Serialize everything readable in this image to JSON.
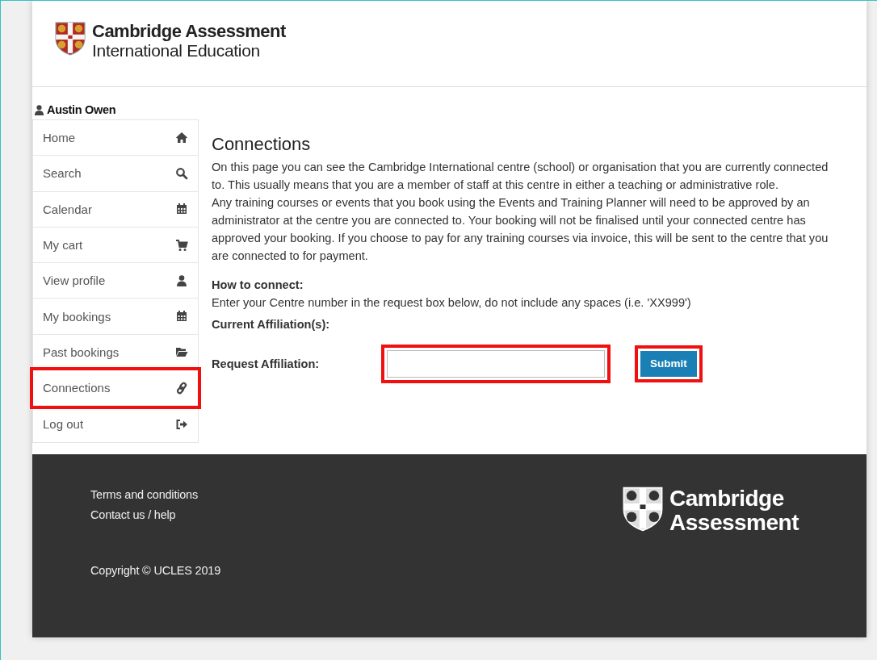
{
  "header": {
    "logo_line1": "Cambridge Assessment",
    "logo_line2": "International Education"
  },
  "user": {
    "name": "Austin Owen"
  },
  "nav": [
    {
      "label": "Home",
      "highlighted": false
    },
    {
      "label": "Search",
      "highlighted": false
    },
    {
      "label": "Calendar",
      "highlighted": false
    },
    {
      "label": "My cart",
      "highlighted": false
    },
    {
      "label": "View profile",
      "highlighted": false
    },
    {
      "label": "My bookings",
      "highlighted": false
    },
    {
      "label": "Past bookings",
      "highlighted": false
    },
    {
      "label": "Connections",
      "highlighted": true
    },
    {
      "label": "Log out",
      "highlighted": false
    }
  ],
  "content": {
    "title": "Connections",
    "paragraphs": [
      "On this page you can see the Cambridge International centre (school) or organisation that you are currently connected to. This usually means that you are a member of staff at this centre in either a teaching or administrative role.",
      "Any training courses or events that you book using the Events and Training Planner will need to be approved by an administrator at the centre you are connected to. Your booking will not be finalised until your connected centre has approved your booking. If you choose to pay for any training courses via invoice, this will be sent to the centre that you are connected to for payment."
    ],
    "how_heading": "How to connect:",
    "how_text": "Enter your Centre number in the request box below, do not include any spaces (i.e. 'XX999')",
    "current_label": "Current Affiliation(s):",
    "request_label": "Request Affiliation:",
    "request_field": {
      "highlighted": true
    },
    "submit": {
      "label": "Submit",
      "highlighted": true
    }
  },
  "footer": {
    "links": [
      "Terms and conditions",
      "Contact us / help"
    ],
    "copyright": "Copyright © UCLES 2019",
    "logo_line1": "Cambridge",
    "logo_line2": "Assessment"
  }
}
